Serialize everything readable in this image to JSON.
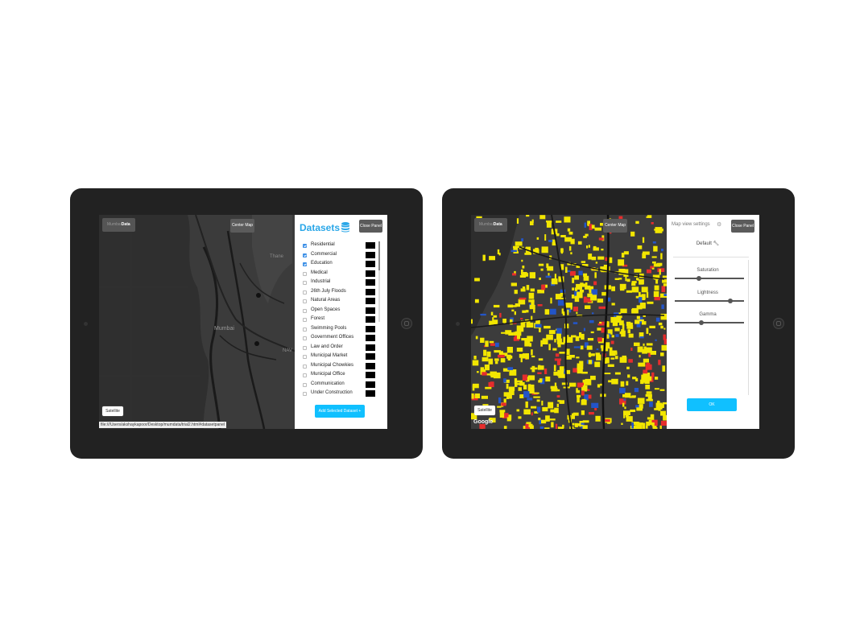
{
  "left_tablet": {
    "logo": {
      "light": "Mumbai",
      "bold": "Data"
    },
    "center_map_button": "Center Map",
    "close_panel_button": "Close Panel",
    "satellite_button": "Satellite",
    "url": "file:///Users/akshaykapoor/Desktop/mumdata/trial2.html#datasetpanel",
    "map_labels": [
      "Thane",
      "Mumbai",
      "NAV"
    ],
    "datasets_panel": {
      "title": "Datasets",
      "items": [
        {
          "label": "Residential",
          "checked": true
        },
        {
          "label": "Commercial",
          "checked": true
        },
        {
          "label": "Education",
          "checked": true
        },
        {
          "label": "Medical",
          "checked": false
        },
        {
          "label": "Industrial",
          "checked": false
        },
        {
          "label": "26th July Floods",
          "checked": false
        },
        {
          "label": "Natural Areas",
          "checked": false
        },
        {
          "label": "Open Spaces",
          "checked": false
        },
        {
          "label": "Forest",
          "checked": false
        },
        {
          "label": "Swimming Pools",
          "checked": false
        },
        {
          "label": "Government Offices",
          "checked": false
        },
        {
          "label": "Law and Order",
          "checked": false
        },
        {
          "label": "Municipal Market",
          "checked": false
        },
        {
          "label": "Municipal Chowkies",
          "checked": false
        },
        {
          "label": "Municipal Office",
          "checked": false
        },
        {
          "label": "Communication",
          "checked": false
        },
        {
          "label": "Under Construction",
          "checked": false
        }
      ],
      "add_button": "Add Selected Dataset +",
      "accent_color": "#2aa7e8"
    }
  },
  "right_tablet": {
    "logo": {
      "light": "Mumbai",
      "bold": "Data"
    },
    "center_map_button": "Center Map",
    "close_panel_button": "Close Panel",
    "satellite_button": "Satellite",
    "google_logo": "Google",
    "settings_panel": {
      "title": "Map view settings",
      "default_label": "Default",
      "sliders": [
        {
          "label": "Saturation",
          "value": 0.35
        },
        {
          "label": "Lightness",
          "value": 0.8
        },
        {
          "label": "Gamma",
          "value": 0.38
        }
      ],
      "ok_button": "OK"
    },
    "dataset_colors": {
      "residential": "#f2e600",
      "commercial": "#e52d2d",
      "education": "#2355c8"
    }
  }
}
